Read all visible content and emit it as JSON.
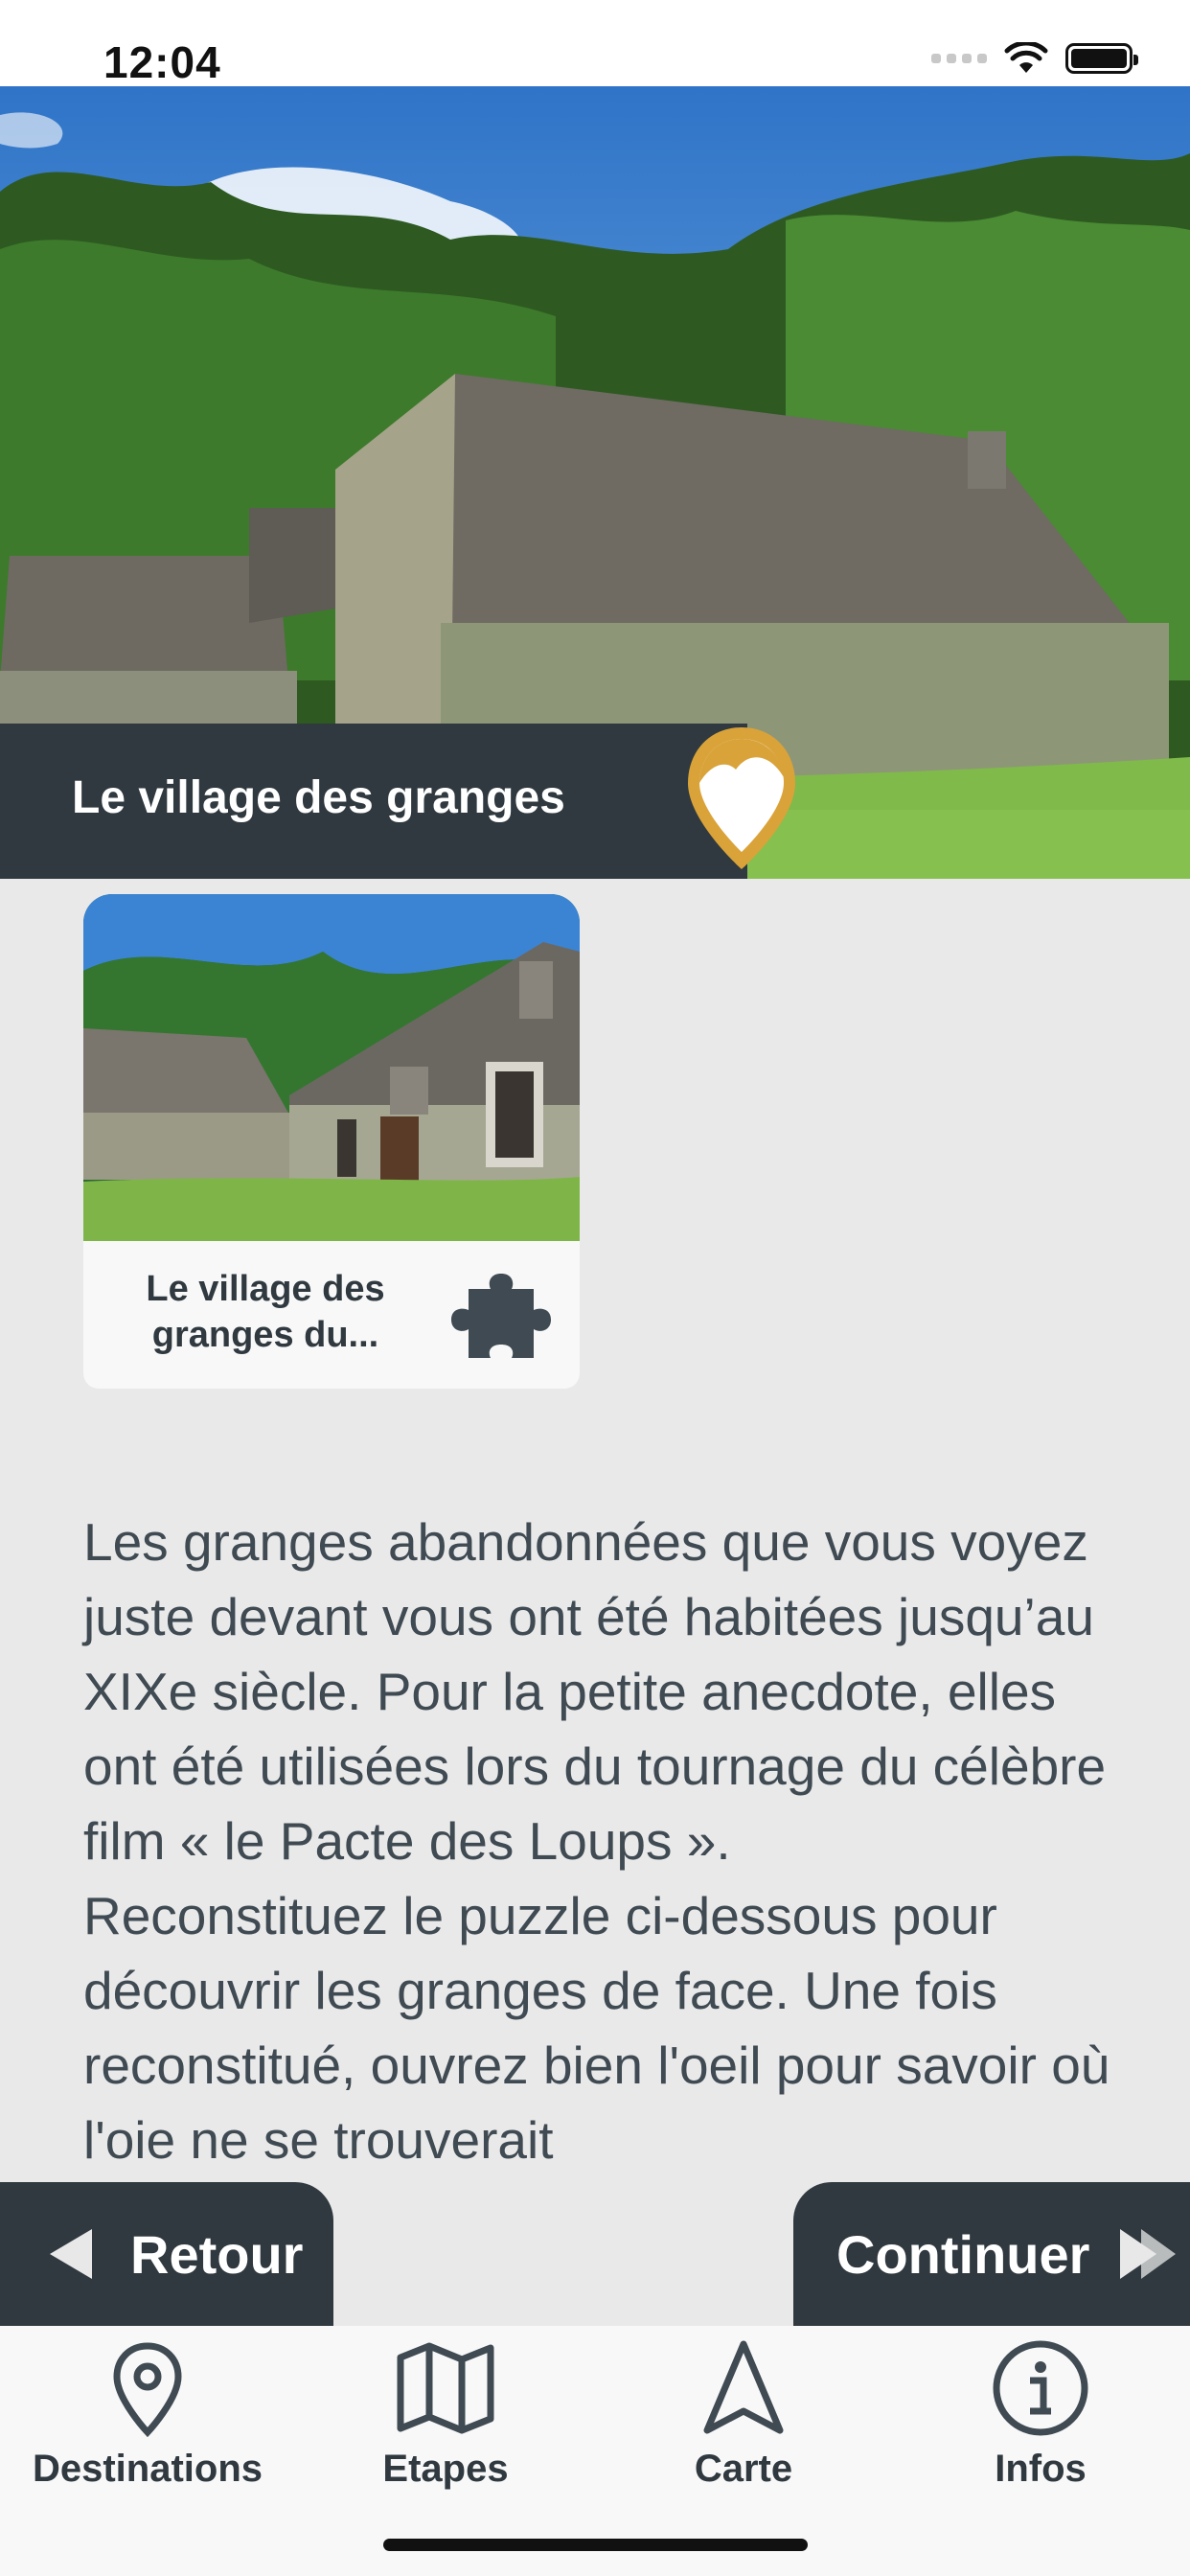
{
  "status_bar": {
    "time": "12:04"
  },
  "header": {
    "title": "Le village des granges"
  },
  "card": {
    "title": "Le village des granges du..."
  },
  "description": {
    "paragraphs": [
      "Les granges abandonnées que vous voyez juste devant vous ont été habitées jusqu’au XIXe siècle. Pour la petite anecdote, elles ont été utilisées lors du tournage du célèbre film « le Pacte des Loups ».",
      "Reconstituez le puzzle ci-dessous pour découvrir les granges de face. Une fois reconstitué, ouvrez bien l'oeil pour savoir où l'oie ne se trouverait"
    ]
  },
  "nav_buttons": {
    "back": "Retour",
    "next": "Continuer"
  },
  "tabbar": {
    "items": [
      {
        "label": "Destinations",
        "icon": "location-pin-icon"
      },
      {
        "label": "Etapes",
        "icon": "map-icon"
      },
      {
        "label": "Carte",
        "icon": "navigation-arrow-icon"
      },
      {
        "label": "Infos",
        "icon": "info-icon"
      }
    ]
  },
  "colors": {
    "dark": "#2f393f",
    "accent": "#d9a33a",
    "background": "#e9e9e9"
  }
}
